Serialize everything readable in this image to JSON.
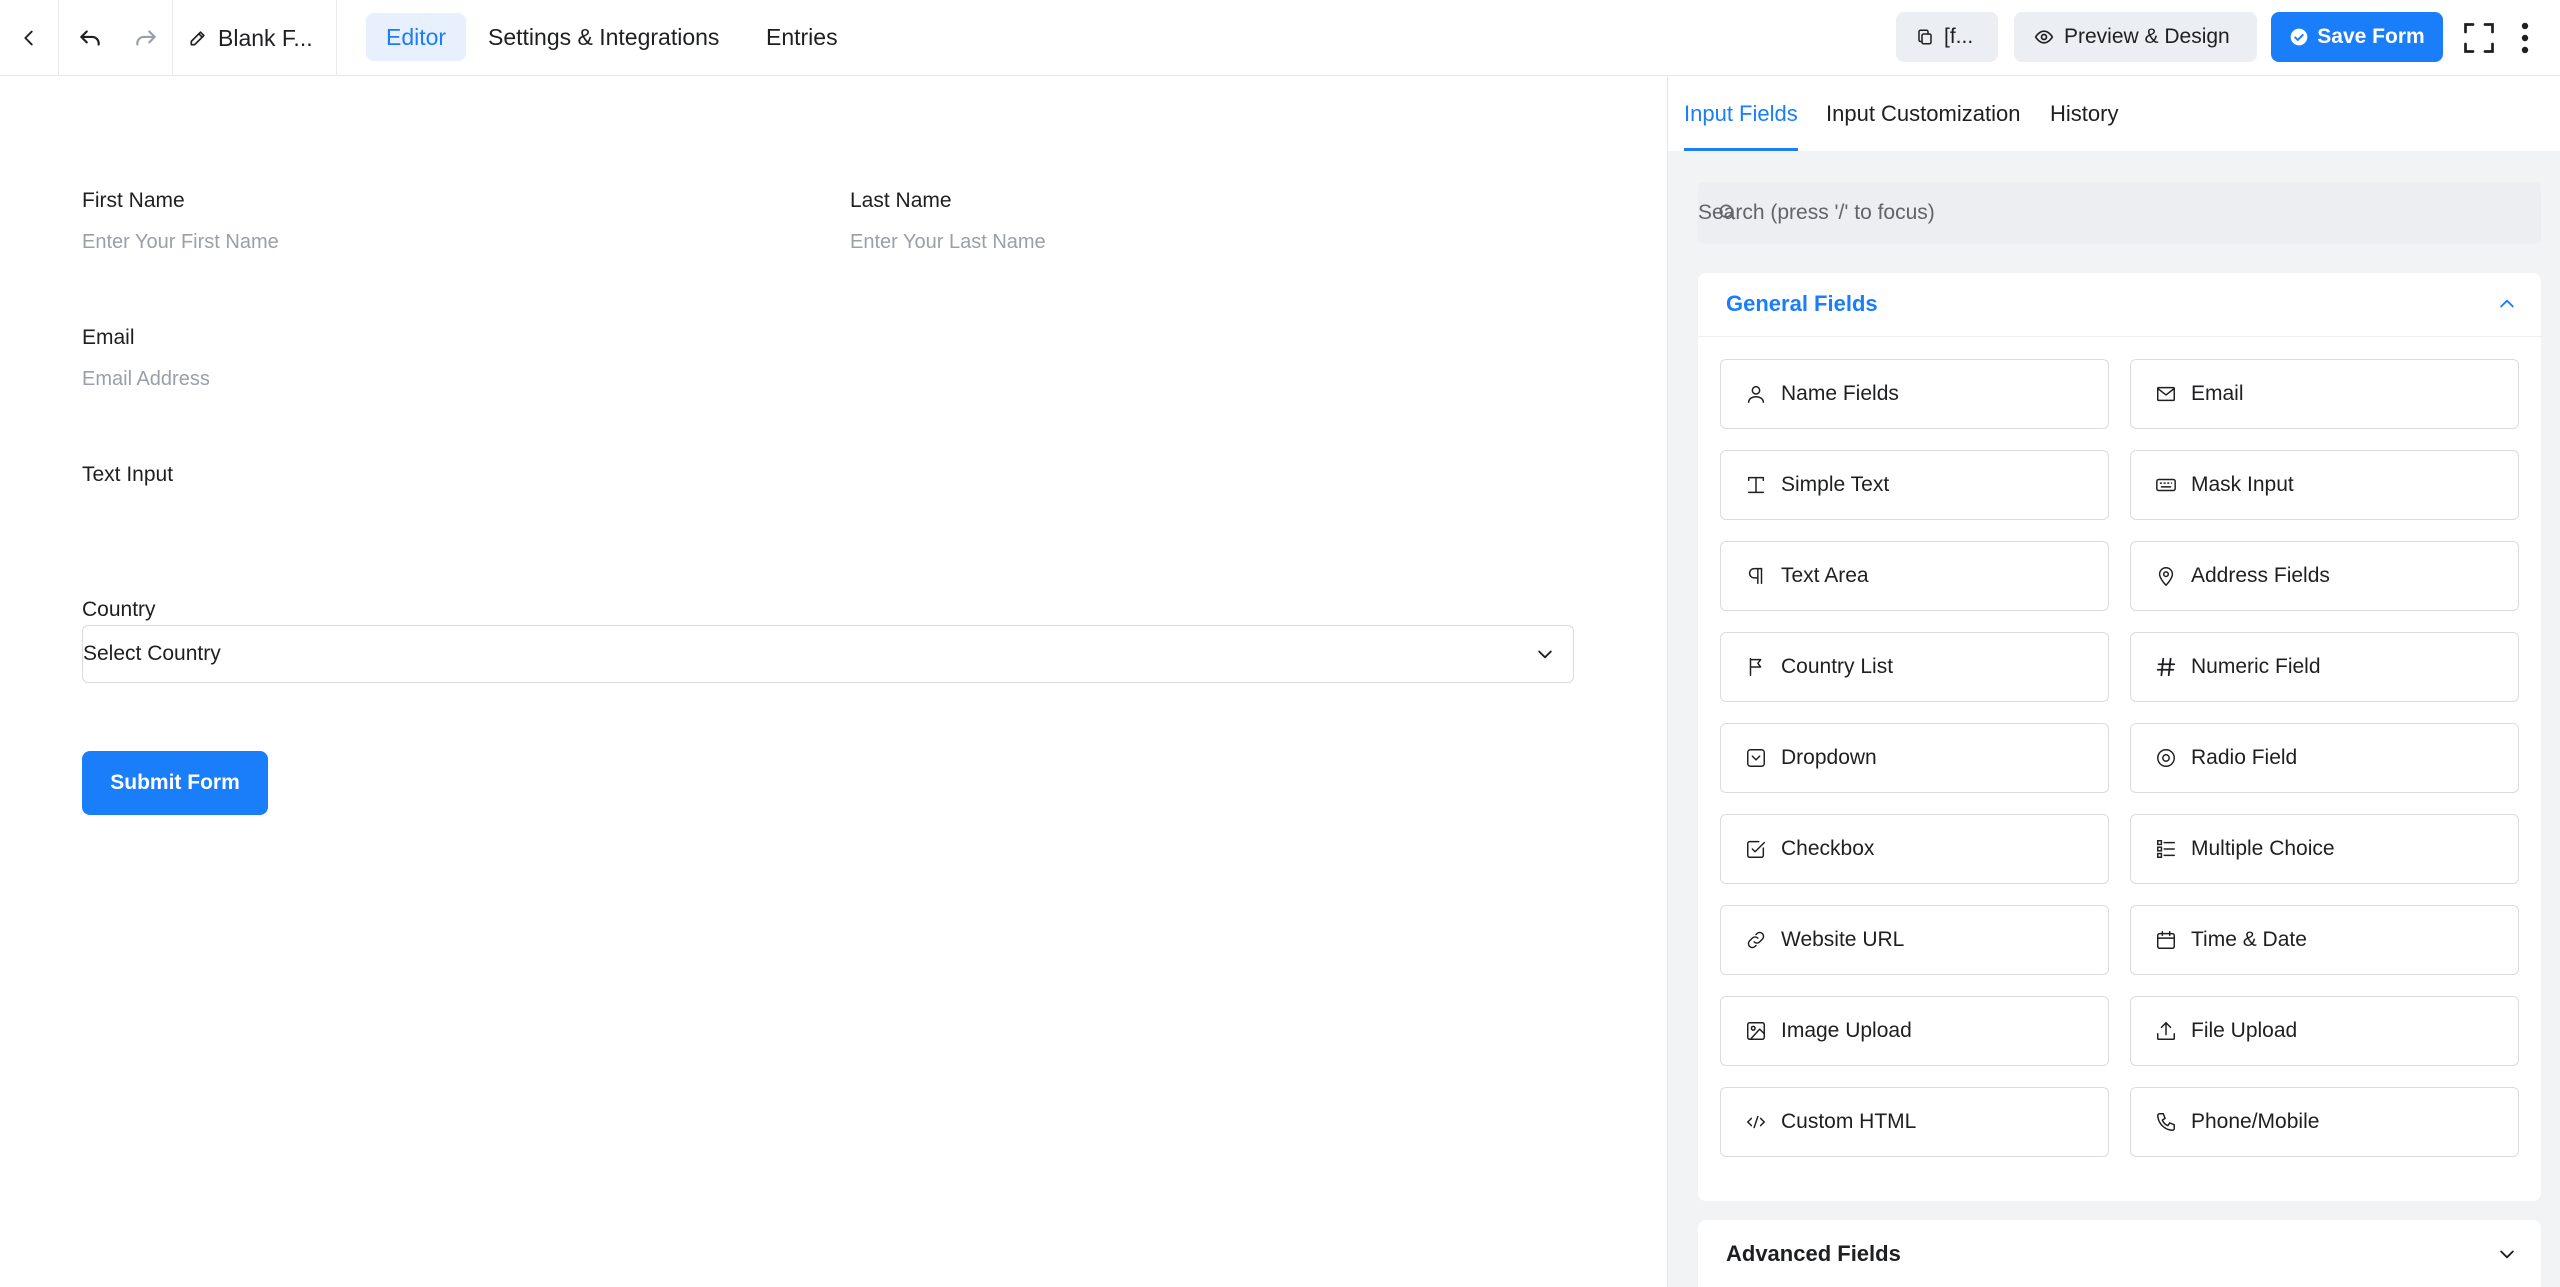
{
  "topbar": {
    "form_name": "Blank F...",
    "tabs": [
      "Editor",
      "Settings & Integrations",
      "Entries"
    ],
    "shortcode_label": "[f...",
    "preview_label": "Preview & Design",
    "save_label": "Save Form"
  },
  "form": {
    "first_name": {
      "label": "First Name",
      "placeholder": "Enter Your First Name"
    },
    "last_name": {
      "label": "Last Name",
      "placeholder": "Enter Your Last Name"
    },
    "email": {
      "label": "Email",
      "placeholder": "Email Address"
    },
    "text_input": {
      "label": "Text Input",
      "placeholder": ""
    },
    "country": {
      "label": "Country",
      "selected": "Select Country"
    },
    "submit_label": "Submit Form"
  },
  "panel": {
    "tabs": [
      "Input Fields",
      "Input Customization",
      "History"
    ],
    "search_placeholder": "Search (press '/' to focus)",
    "general_title": "General Fields",
    "advanced_title": "Advanced Fields",
    "fields": [
      {
        "label": "Name Fields",
        "icon": "user-icon"
      },
      {
        "label": "Email",
        "icon": "mail-icon"
      },
      {
        "label": "Simple Text",
        "icon": "text-cursor-icon"
      },
      {
        "label": "Mask Input",
        "icon": "keyboard-icon"
      },
      {
        "label": "Text Area",
        "icon": "paragraph-icon"
      },
      {
        "label": "Address Fields",
        "icon": "map-pin-icon"
      },
      {
        "label": "Country List",
        "icon": "flag-icon"
      },
      {
        "label": "Numeric Field",
        "icon": "hash-icon"
      },
      {
        "label": "Dropdown",
        "icon": "dropdown-icon"
      },
      {
        "label": "Radio Field",
        "icon": "radio-icon"
      },
      {
        "label": "Checkbox",
        "icon": "checkbox-icon"
      },
      {
        "label": "Multiple Choice",
        "icon": "list-icon"
      },
      {
        "label": "Website URL",
        "icon": "link-icon"
      },
      {
        "label": "Time & Date",
        "icon": "calendar-icon"
      },
      {
        "label": "Image Upload",
        "icon": "image-icon"
      },
      {
        "label": "File Upload",
        "icon": "upload-icon"
      },
      {
        "label": "Custom HTML",
        "icon": "code-icon"
      },
      {
        "label": "Phone/Mobile",
        "icon": "phone-icon"
      }
    ]
  },
  "colors": {
    "accent": "#1a7efb",
    "panel_bg": "#f2f3f5",
    "active_tab_bg": "#e7f0fc"
  }
}
